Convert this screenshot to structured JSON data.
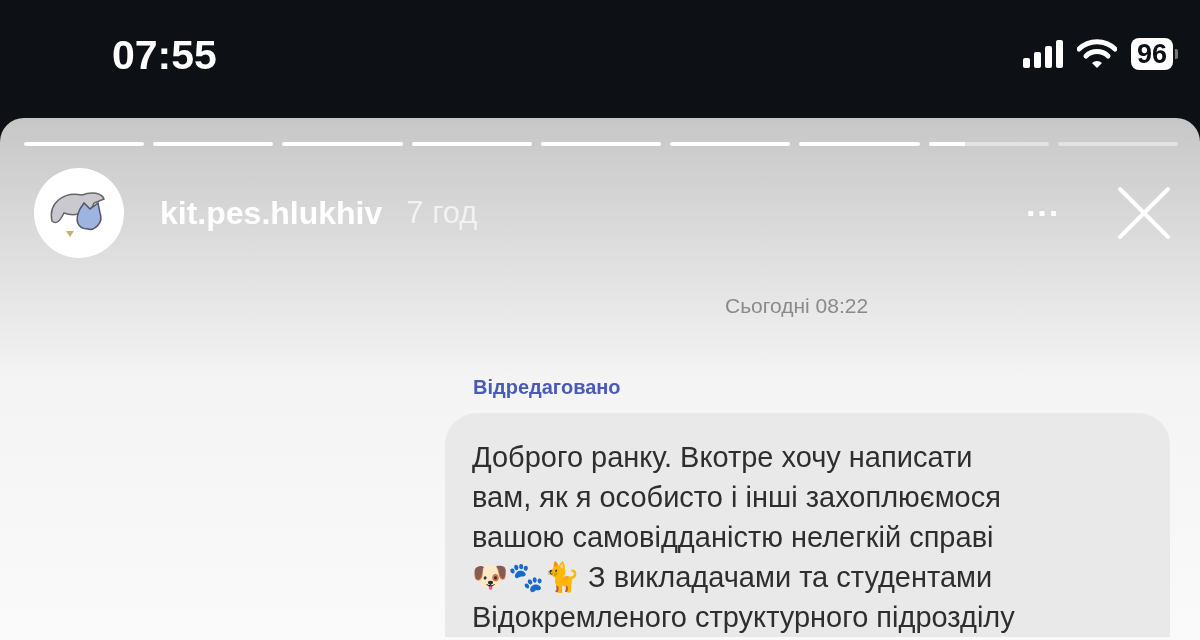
{
  "status_bar": {
    "time": "07:55",
    "battery": "96"
  },
  "story": {
    "progress": [
      {
        "level": 1
      },
      {
        "level": 1
      },
      {
        "level": 1
      },
      {
        "level": 1
      },
      {
        "level": 1
      },
      {
        "level": 1
      },
      {
        "level": 1
      },
      {
        "level": 0.3
      },
      {
        "level": 0
      }
    ],
    "username": "kit.pes.hlukhiv",
    "age": "7 год",
    "menu": "···"
  },
  "chat": {
    "date": "Сьогодні 08:22",
    "edited_label": "Відредаговано",
    "message": "Доброго ранку. Вкотре хочу написати\nвам, як я особисто і інші захоплюємося\nвашою самовідданістю нелегкій справі\n🐶🐾🐈 З викладачами та студентами\nВідокремленого структурного підрозділу"
  }
}
